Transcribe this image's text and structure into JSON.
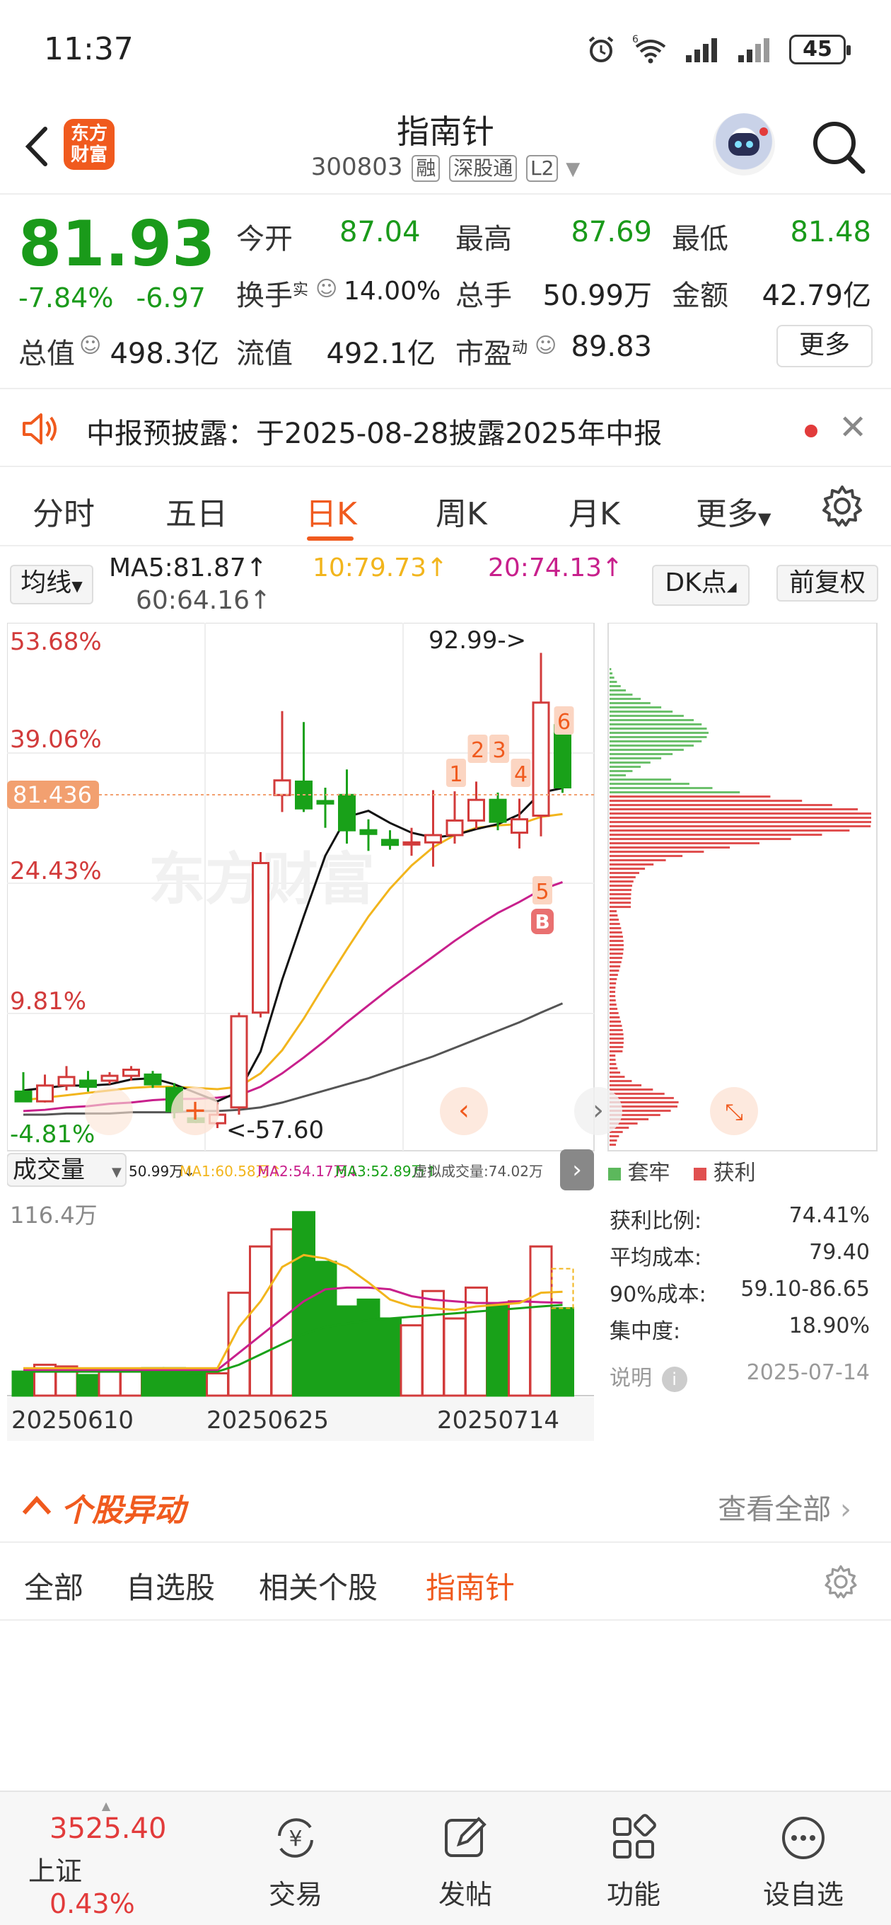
{
  "status_bar": {
    "time": "11:37",
    "battery": "45",
    "wifi_label": "6"
  },
  "header": {
    "logo_text_1": "东方",
    "logo_text_2": "财富",
    "stock_name": "指南针",
    "stock_code": "300803",
    "tags": [
      "融",
      "深股通",
      "L2"
    ]
  },
  "quote": {
    "price": "81.93",
    "change_pct": "-7.84%",
    "change_amt": "-6.97",
    "open_label": "今开",
    "open": "87.04",
    "high_label": "最高",
    "high": "87.69",
    "low_label": "最低",
    "low": "81.48",
    "turnover_label": "换手",
    "turnover_sup": "实",
    "turnover": "14.00%",
    "volume_label": "总手",
    "volume": "50.99万",
    "amount_label": "金额",
    "amount": "42.79亿",
    "mktcap_label": "总值",
    "mktcap": "498.3亿",
    "float_label": "流值",
    "float_cap": "492.1亿",
    "pe_label": "市盈",
    "pe_sup": "动",
    "pe": "89.83",
    "more_label": "更多"
  },
  "notice": {
    "text": "中报预披露：于2025-08-28披露2025年中报"
  },
  "tabs": [
    "分时",
    "五日",
    "日K",
    "周K",
    "月K",
    "更多"
  ],
  "active_tab": "日K",
  "ma_row": {
    "indicator": "均线",
    "ma5": "MA5:81.87↑",
    "ma10": "10:79.73↑",
    "ma20": "20:74.13↑",
    "ma60": "60:64.16↑",
    "dk": "DK点",
    "adjust": "前复权"
  },
  "chart": {
    "y_labels": [
      "53.68%",
      "39.06%",
      "24.43%",
      "9.81%",
      "-4.81%"
    ],
    "current_line": "81.436",
    "max_annot": "92.99->",
    "min_annot": "<-57.60",
    "signals": [
      "1",
      "2",
      "3",
      "4",
      "5",
      "6"
    ],
    "buy_mark": "B",
    "watermark": "东方财富",
    "volume_selector": "成交量",
    "volume_stats": {
      "vol": "50.99万↓",
      "ma1": "MA1:60.58万↑",
      "ma2": "MA2:54.17万↓",
      "ma3": "MA3:52.89万↑",
      "virtual": "虚拟成交量:74.02万"
    },
    "volume_max": "116.4万",
    "dates": [
      "20250610",
      "20250625",
      "20250714"
    ],
    "colors": {
      "up": "#d23b3b",
      "down": "#19a119",
      "ma5": "#111111",
      "ma10": "#f2b51c",
      "ma20": "#c8208c",
      "ma60": "#555555"
    }
  },
  "chart_data": {
    "type": "candlestick",
    "candles": [
      {
        "o": 56.9,
        "h": 58.5,
        "l": 56.3,
        "c": 56.1
      },
      {
        "o": 56.1,
        "h": 58.3,
        "l": 56.0,
        "c": 57.4
      },
      {
        "o": 57.4,
        "h": 59.0,
        "l": 57.0,
        "c": 58.1
      },
      {
        "o": 57.8,
        "h": 58.6,
        "l": 56.9,
        "c": 57.3
      },
      {
        "o": 57.8,
        "h": 58.5,
        "l": 57.5,
        "c": 58.2
      },
      {
        "o": 58.2,
        "h": 59.0,
        "l": 57.8,
        "c": 58.7
      },
      {
        "o": 58.3,
        "h": 58.6,
        "l": 57.2,
        "c": 57.5
      },
      {
        "o": 57.2,
        "h": 57.6,
        "l": 54.7,
        "c": 55.3
      },
      {
        "o": 54.7,
        "h": 55.0,
        "l": 54.3,
        "c": 54.4
      },
      {
        "o": 54.3,
        "h": 56.0,
        "l": 53.9,
        "c": 55.0
      },
      {
        "o": 55.6,
        "h": 63.4,
        "l": 55.0,
        "c": 63.1
      },
      {
        "o": 63.4,
        "h": 76.6,
        "l": 63.0,
        "c": 75.7
      },
      {
        "o": 81.3,
        "h": 88.2,
        "l": 79.9,
        "c": 82.5
      },
      {
        "o": 82.4,
        "h": 87.3,
        "l": 79.9,
        "c": 80.2
      },
      {
        "o": 80.8,
        "h": 81.9,
        "l": 78.6,
        "c": 80.6
      },
      {
        "o": 81.3,
        "h": 83.4,
        "l": 77.3,
        "c": 78.4
      },
      {
        "o": 78.4,
        "h": 79.3,
        "l": 76.7,
        "c": 78.1
      },
      {
        "o": 77.6,
        "h": 78.4,
        "l": 76.8,
        "c": 77.2
      },
      {
        "o": 77.3,
        "h": 78.6,
        "l": 76.3,
        "c": 77.4
      },
      {
        "o": 77.4,
        "h": 81.7,
        "l": 75.4,
        "c": 78.0
      },
      {
        "o": 78.0,
        "h": 81.6,
        "l": 77.3,
        "c": 79.2
      },
      {
        "o": 79.2,
        "h": 82.4,
        "l": 78.5,
        "c": 80.9
      },
      {
        "o": 80.9,
        "h": 81.5,
        "l": 78.4,
        "c": 79.1
      },
      {
        "o": 78.2,
        "h": 81.0,
        "l": 76.9,
        "c": 79.3
      },
      {
        "o": 79.6,
        "h": 92.99,
        "l": 77.9,
        "c": 88.9
      },
      {
        "o": 87.04,
        "h": 87.69,
        "l": 81.48,
        "c": 81.93
      }
    ],
    "ma5": [
      57.0,
      57.2,
      57.4,
      57.4,
      57.5,
      57.9,
      58.0,
      57.5,
      56.8,
      56.1,
      56.9,
      60.2,
      66.1,
      71.3,
      76.3,
      79.5,
      80.0,
      79.0,
      78.2,
      77.8,
      78.0,
      78.5,
      78.9,
      79.7,
      81.5,
      81.87
    ],
    "ma10": [
      56.2,
      56.4,
      56.6,
      56.8,
      57.0,
      57.2,
      57.3,
      57.3,
      57.2,
      57.1,
      57.3,
      58.4,
      60.3,
      62.9,
      65.8,
      68.6,
      71.3,
      73.6,
      75.5,
      77.0,
      78.0,
      78.6,
      78.8,
      78.9,
      79.5,
      79.73
    ],
    "ma20": [
      55.3,
      55.4,
      55.6,
      55.7,
      55.9,
      56.0,
      56.2,
      56.3,
      56.3,
      56.4,
      56.6,
      57.3,
      58.4,
      59.7,
      61.1,
      62.6,
      64.0,
      65.4,
      66.7,
      68.0,
      69.3,
      70.5,
      71.6,
      72.5,
      73.5,
      74.13
    ],
    "ma60": [
      55.0,
      55.0,
      55.1,
      55.1,
      55.1,
      55.2,
      55.2,
      55.2,
      55.3,
      55.3,
      55.4,
      55.6,
      56.0,
      56.5,
      57.0,
      57.5,
      58.0,
      58.6,
      59.2,
      59.8,
      60.5,
      61.2,
      61.9,
      62.6,
      63.4,
      64.16
    ],
    "volumes": [
      14,
      18,
      17,
      12,
      15,
      15,
      16,
      16,
      13,
      13,
      60,
      87,
      97,
      107,
      78,
      52,
      56,
      45,
      41,
      61,
      45,
      63,
      53,
      55,
      87,
      50.99
    ],
    "vol_ma1": [
      16,
      16,
      16,
      16,
      16,
      16,
      16,
      16,
      16,
      16,
      40,
      55,
      75,
      82,
      80,
      75,
      66,
      56,
      52,
      51,
      50,
      52,
      53,
      54,
      60,
      60.58
    ],
    "vol_ma2": [
      15,
      15,
      15,
      15,
      15,
      15,
      15,
      15,
      15,
      15,
      25,
      35,
      45,
      55,
      62,
      63,
      63,
      62,
      58,
      56,
      55,
      54,
      54,
      55,
      54.5,
      54.17
    ],
    "vol_ma3": [
      14,
      14,
      14,
      14,
      14,
      14,
      14,
      14,
      14,
      14,
      18,
      24,
      30,
      36,
      40,
      42,
      44,
      45,
      46,
      47,
      48,
      49,
      50,
      51,
      52,
      52.89
    ],
    "y_range": [
      52.5,
      95.0
    ],
    "virtual_volume": 74.02,
    "chip_legend": [
      "套牢",
      "获利"
    ],
    "chip_stats": [
      {
        "label": "获利比例:",
        "value": "74.41%"
      },
      {
        "label": "平均成本:",
        "value": "79.40"
      },
      {
        "label": "90%成本:",
        "value": "59.10-86.65"
      },
      {
        "label": "集中度:",
        "value": "18.90%"
      }
    ],
    "chip_note_label": "说明",
    "chip_date": "2025-07-14"
  },
  "anomaly": {
    "title": "个股异动",
    "view_all": "查看全部"
  },
  "filters": [
    "全部",
    "自选股",
    "相关个股",
    "指南针"
  ],
  "active_filter": "指南针",
  "bottom_nav": {
    "index_value": "3525.40",
    "index_name": "上证",
    "index_change": "0.43%",
    "items": [
      "交易",
      "发帖",
      "功能",
      "设自选"
    ]
  }
}
